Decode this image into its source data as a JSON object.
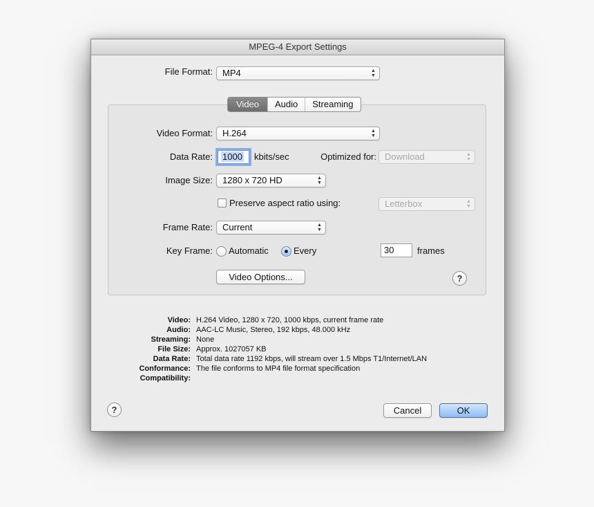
{
  "window": {
    "title": "MPEG-4 Export Settings"
  },
  "file_format": {
    "label": "File Format:",
    "value": "MP4"
  },
  "tabs": [
    {
      "label": "Video",
      "active": true
    },
    {
      "label": "Audio",
      "active": false
    },
    {
      "label": "Streaming",
      "active": false
    }
  ],
  "video": {
    "video_format": {
      "label": "Video Format:",
      "value": "H.264"
    },
    "data_rate": {
      "label": "Data Rate:",
      "value": "1000",
      "unit": "kbits/sec"
    },
    "optimized_for": {
      "label": "Optimized for:",
      "value": "Download",
      "enabled": false
    },
    "image_size": {
      "label": "Image Size:",
      "value": "1280 x 720 HD"
    },
    "preserve_aspect": {
      "label": "Preserve aspect ratio using:",
      "checked": false,
      "value": "Letterbox",
      "enabled": false
    },
    "frame_rate": {
      "label": "Frame Rate:",
      "value": "Current"
    },
    "key_frame": {
      "label": "Key Frame:",
      "options": [
        {
          "label": "Automatic",
          "selected": false
        },
        {
          "label": "Every",
          "selected": true
        }
      ],
      "frames_value": "30",
      "frames_unit": "frames"
    },
    "video_options_button": "Video Options...",
    "help_symbol": "?"
  },
  "summary": [
    {
      "key": "Video:",
      "value": "H.264 Video, 1280 x 720, 1000 kbps, current frame rate"
    },
    {
      "key": "Audio:",
      "value": "AAC-LC Music, Stereo, 192 kbps, 48.000 kHz"
    },
    {
      "key": "Streaming:",
      "value": "None"
    },
    {
      "key": "File Size:",
      "value": "Approx. 1027057 KB"
    },
    {
      "key": "Data Rate:",
      "value": "Total data rate 1192 kbps, will stream over 1.5 Mbps T1/Internet/LAN"
    },
    {
      "key": "Conformance:",
      "value": "The file conforms to MP4 file format specification"
    },
    {
      "key": "Compatibility:",
      "value": ""
    }
  ],
  "footer": {
    "help_symbol": "?",
    "cancel_label": "Cancel",
    "ok_label": "OK"
  },
  "colors": {
    "accent_default_button": "#8ebcf5",
    "focus_ring": "#88aee6",
    "active_tab": "#7a7a7a"
  }
}
